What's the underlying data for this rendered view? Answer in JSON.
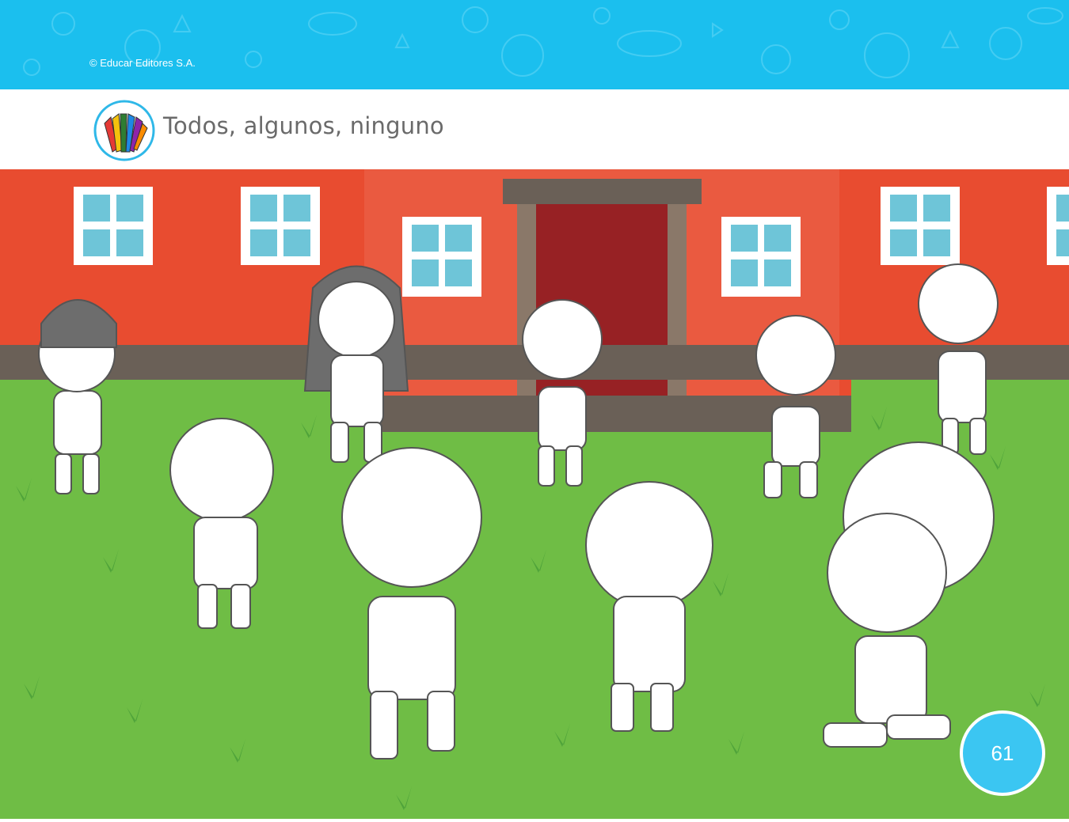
{
  "header": {
    "copyright": "© Educar Editores S.A.",
    "banner_color": "#1bbfee"
  },
  "activity": {
    "title": "Todos, algunos, ninguno",
    "icon": "colored-pencils-icon"
  },
  "illustration": {
    "description_icon": "children-playing-in-schoolyard",
    "building_color": "#e84c30",
    "grass_color": "#6fbd45",
    "door_color": "#972124",
    "window_color": "#6ec5d8"
  },
  "footer": {
    "page_number": "61",
    "badge_color": "#3bc6f2"
  }
}
